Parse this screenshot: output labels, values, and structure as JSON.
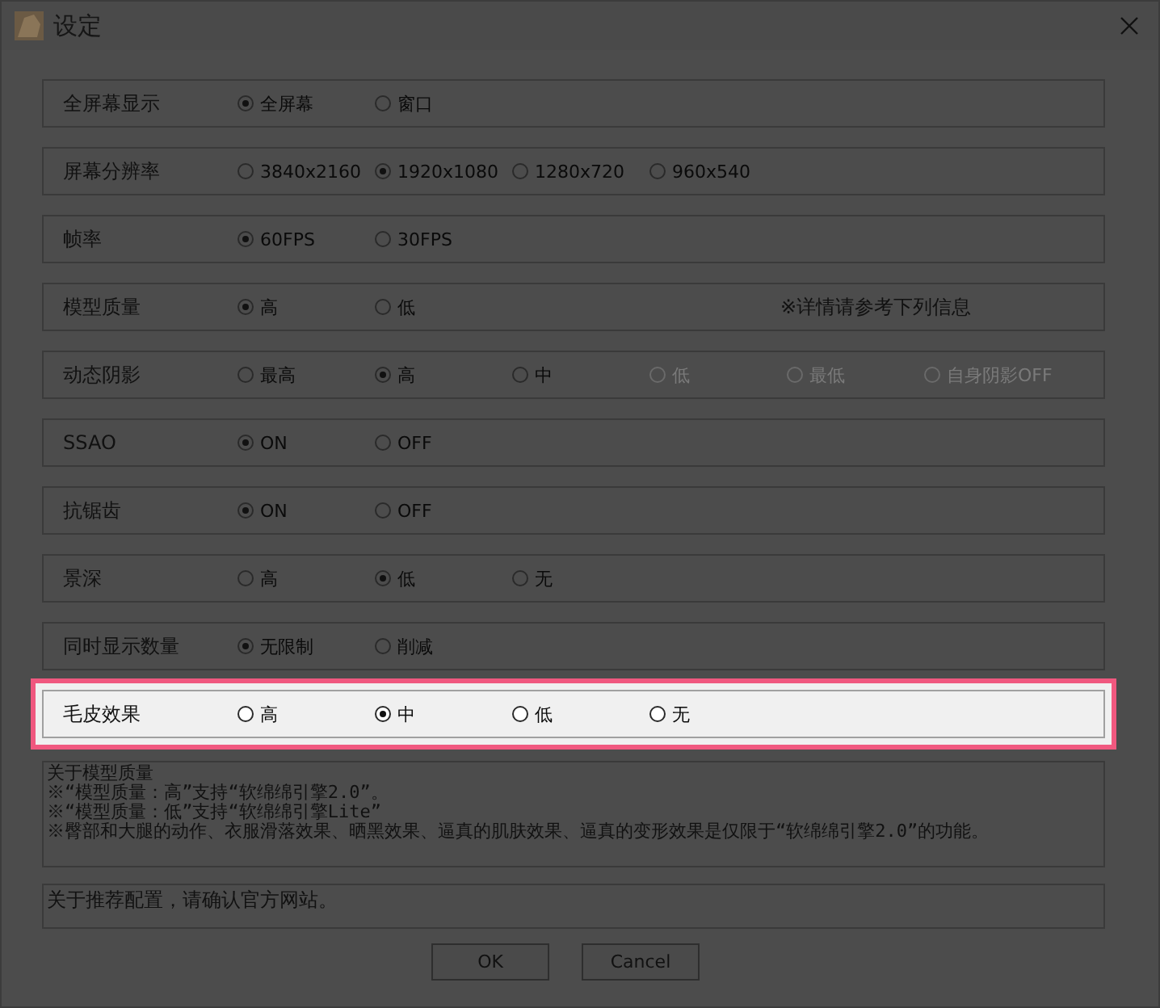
{
  "window": {
    "title": "设定"
  },
  "settings": [
    {
      "label": "全屏幕显示",
      "highlighted": false,
      "options": [
        {
          "label": "全屏幕",
          "selected": true,
          "disabled": false
        },
        {
          "label": "窗口",
          "selected": false,
          "disabled": false
        }
      ]
    },
    {
      "label": "屏幕分辨率",
      "highlighted": false,
      "options": [
        {
          "label": "3840x2160",
          "selected": false,
          "disabled": false
        },
        {
          "label": "1920x1080",
          "selected": true,
          "disabled": false
        },
        {
          "label": "1280x720",
          "selected": false,
          "disabled": false
        },
        {
          "label": "960x540",
          "selected": false,
          "disabled": false
        }
      ]
    },
    {
      "label": "帧率",
      "highlighted": false,
      "options": [
        {
          "label": "60FPS",
          "selected": true,
          "disabled": false
        },
        {
          "label": "30FPS",
          "selected": false,
          "disabled": false
        }
      ]
    },
    {
      "label": "模型质量",
      "highlighted": false,
      "note": "※详情请参考下列信息",
      "options": [
        {
          "label": "高",
          "selected": true,
          "disabled": false
        },
        {
          "label": "低",
          "selected": false,
          "disabled": false
        }
      ]
    },
    {
      "label": "动态阴影",
      "highlighted": false,
      "options": [
        {
          "label": "最高",
          "selected": false,
          "disabled": false
        },
        {
          "label": "高",
          "selected": true,
          "disabled": false
        },
        {
          "label": "中",
          "selected": false,
          "disabled": false
        },
        {
          "label": "低",
          "selected": false,
          "disabled": true
        },
        {
          "label": "最低",
          "selected": false,
          "disabled": true
        },
        {
          "label": "自身阴影OFF",
          "selected": false,
          "disabled": true
        }
      ]
    },
    {
      "label": "SSAO",
      "highlighted": false,
      "options": [
        {
          "label": "ON",
          "selected": true,
          "disabled": false
        },
        {
          "label": "OFF",
          "selected": false,
          "disabled": false
        }
      ]
    },
    {
      "label": "抗锯齿",
      "highlighted": false,
      "options": [
        {
          "label": "ON",
          "selected": true,
          "disabled": false
        },
        {
          "label": "OFF",
          "selected": false,
          "disabled": false
        }
      ]
    },
    {
      "label": "景深",
      "highlighted": false,
      "options": [
        {
          "label": "高",
          "selected": false,
          "disabled": false
        },
        {
          "label": "低",
          "selected": true,
          "disabled": false
        },
        {
          "label": "无",
          "selected": false,
          "disabled": false
        }
      ]
    },
    {
      "label": "同时显示数量",
      "highlighted": false,
      "options": [
        {
          "label": "无限制",
          "selected": true,
          "disabled": false
        },
        {
          "label": "削减",
          "selected": false,
          "disabled": false
        }
      ]
    },
    {
      "label": "毛皮效果",
      "highlighted": true,
      "options": [
        {
          "label": "高",
          "selected": false,
          "disabled": false
        },
        {
          "label": "中",
          "selected": true,
          "disabled": false
        },
        {
          "label": "低",
          "selected": false,
          "disabled": false
        },
        {
          "label": "无",
          "selected": false,
          "disabled": false
        }
      ]
    }
  ],
  "info_lines": [
    "关于模型质量",
    "※“模型质量：高”支持“软绵绵引擎2.0”。",
    "※“模型质量：低”支持“软绵绵引擎Lite”",
    "※臀部和大腿的动作、衣服滑落效果、晒黑效果、逼真的肌肤效果、逼真的变形效果是仅限于“软绵绵引擎2.0”的功能。"
  ],
  "recommend": "关于推荐配置，请确认官方网站。",
  "buttons": [
    "OK",
    "Cancel"
  ]
}
